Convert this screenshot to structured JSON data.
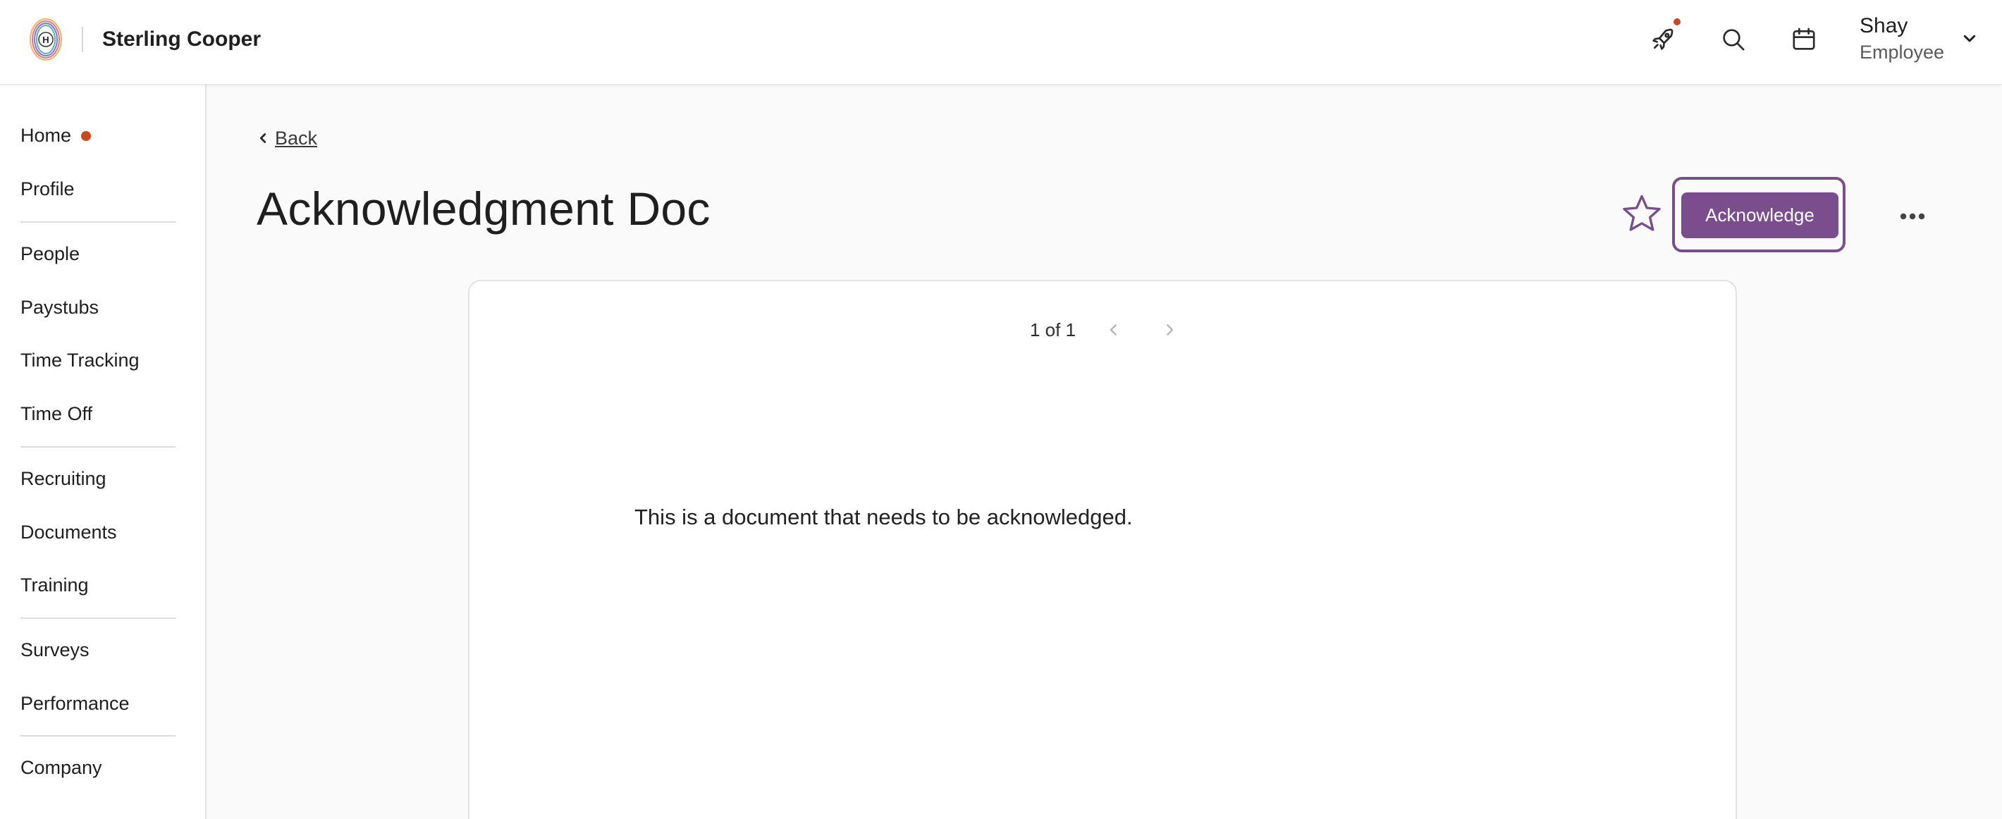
{
  "header": {
    "company_name": "Sterling Cooper",
    "notifications_icon": "rocket-icon",
    "search_icon": "search-icon",
    "calendar_icon": "calendar-icon",
    "user": {
      "name": "Shay",
      "role": "Employee"
    },
    "accent_color": "#7a4e8c",
    "alert_color": "#c9491f"
  },
  "sidebar": {
    "items": [
      {
        "label": "Home",
        "has_badge": true
      },
      {
        "label": "Profile"
      },
      {
        "label": "People"
      },
      {
        "label": "Paystubs"
      },
      {
        "label": "Time Tracking"
      },
      {
        "label": "Time Off"
      },
      {
        "label": "Recruiting"
      },
      {
        "label": "Documents"
      },
      {
        "label": "Training"
      },
      {
        "label": "Surveys"
      },
      {
        "label": "Performance"
      },
      {
        "label": "Company"
      }
    ]
  },
  "main": {
    "back_label": "Back",
    "title": "Acknowledgment Doc",
    "acknowledge_label": "Acknowledge",
    "pager": {
      "text": "1 of 1"
    },
    "document_text": "This is a document that needs to be acknowledged."
  }
}
